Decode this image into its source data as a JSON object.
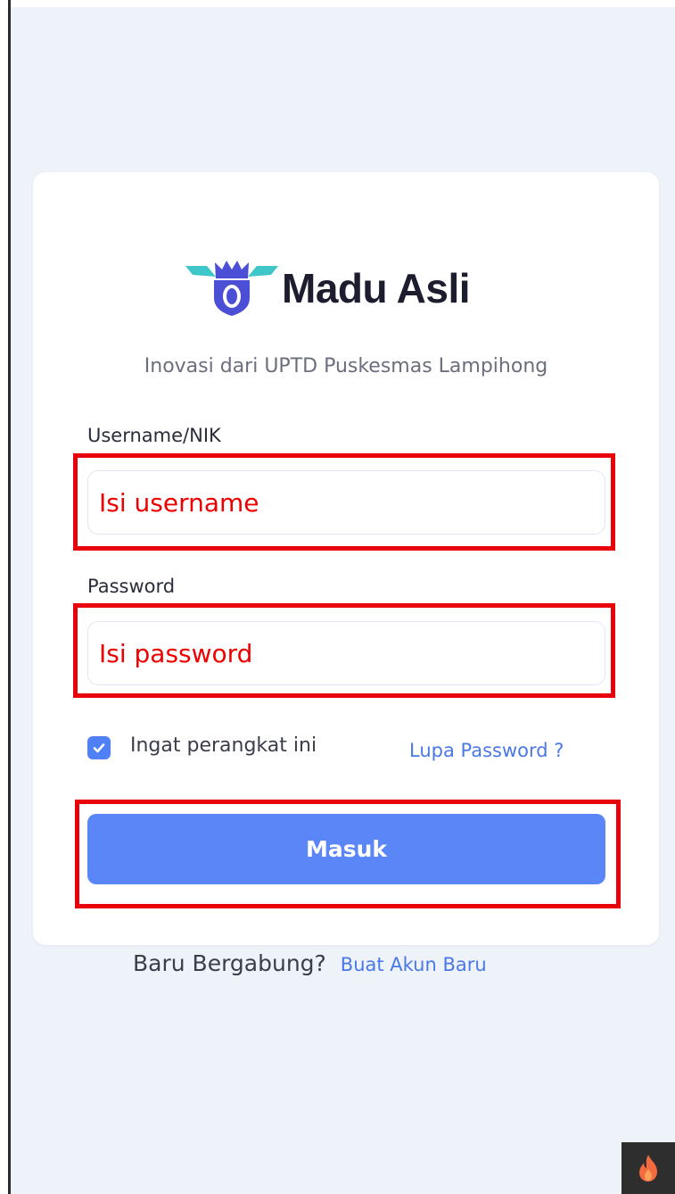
{
  "brand": {
    "name": "Madu Asli",
    "tagline": "Inovasi dari UPTD Puskesmas Lampihong",
    "logo_icon": "winged-shield-icon"
  },
  "form": {
    "username_label": "Username/NIK",
    "username_placeholder": "Isi username",
    "password_label": "Password",
    "password_placeholder": "Isi password",
    "remember_label": "Ingat perangkat ini",
    "remember_checked": true,
    "forgot_link": "Lupa Password ?",
    "submit_label": "Masuk"
  },
  "register": {
    "prompt": "Baru Bergabung?",
    "link": "Buat Akun Baru"
  },
  "floating": {
    "icon": "flame-icon"
  },
  "colors": {
    "accent": "#5b86f7",
    "link": "#4a78e6",
    "callout": "#e8000b",
    "background": "#eef2f9"
  }
}
